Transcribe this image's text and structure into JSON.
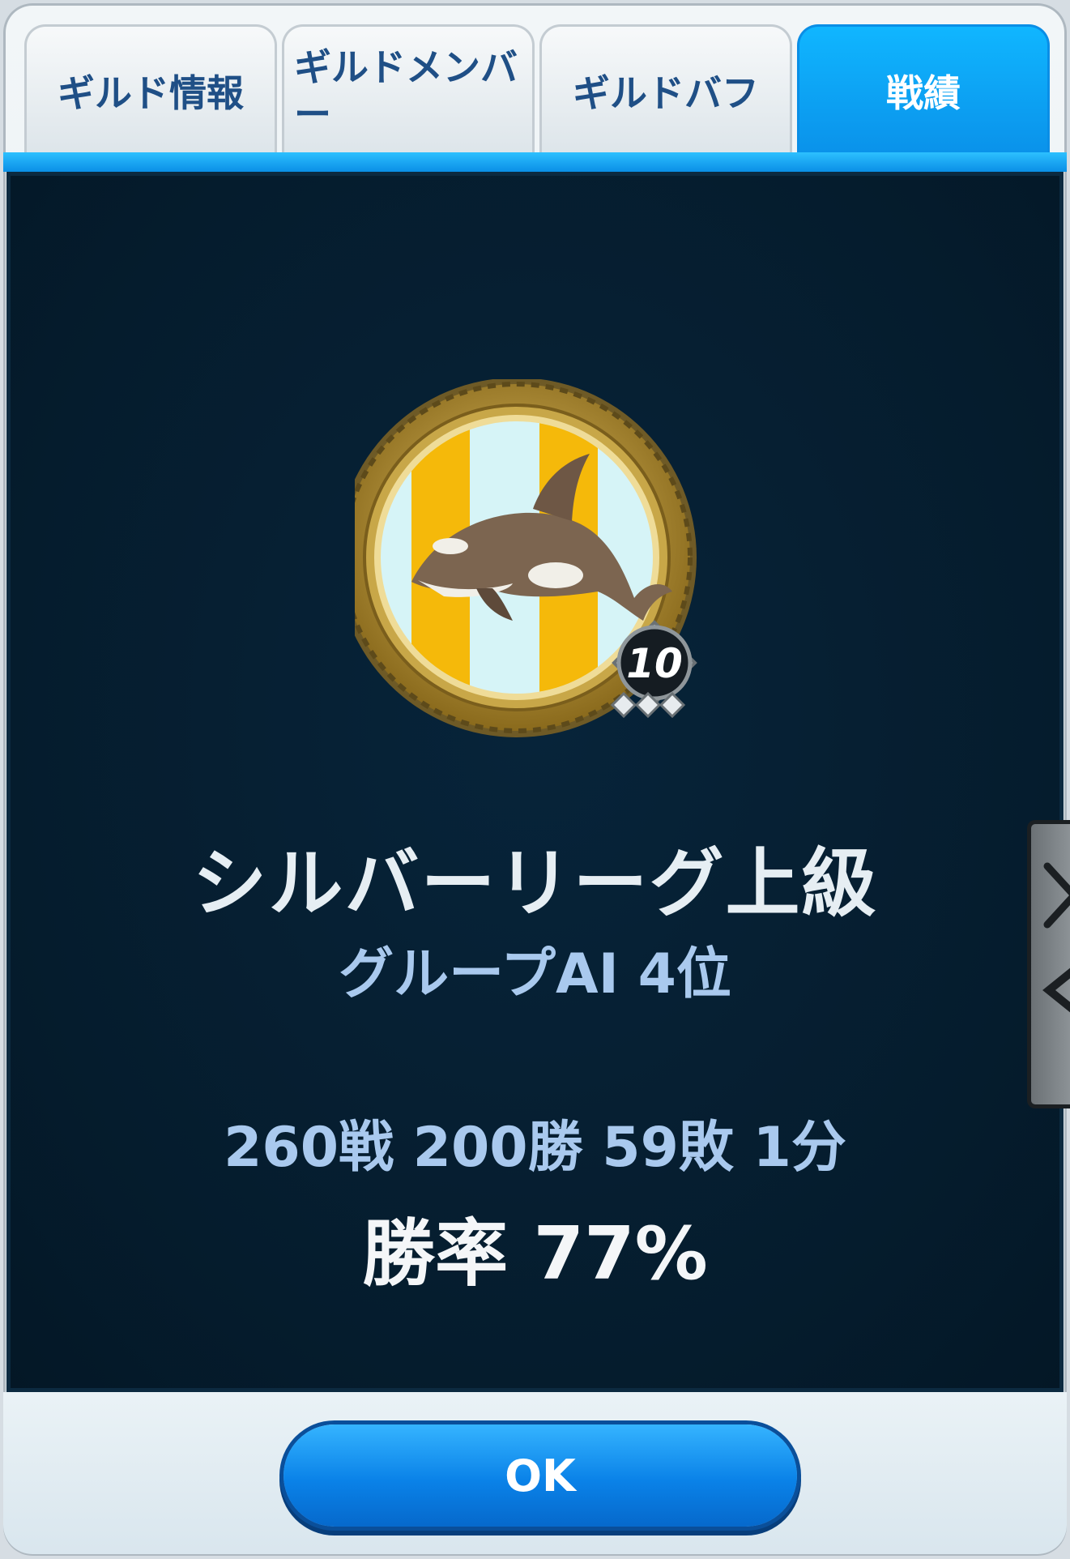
{
  "tabs": [
    {
      "label": "ギルド情報",
      "active": false
    },
    {
      "label": "ギルドメンバー",
      "active": false
    },
    {
      "label": "ギルドバフ",
      "active": false
    },
    {
      "label": "戦績",
      "active": true
    }
  ],
  "emblem": {
    "icon": "orca-medal-icon",
    "badge_number": "10",
    "colors": {
      "stripe_a": "#f5b90a",
      "stripe_b": "#d6f4f7",
      "rim": "#b08a2a"
    }
  },
  "result": {
    "league": "シルバーリーグ上級",
    "group_rank": "グループAI 4位",
    "record": "260戦 200勝 59敗 1分",
    "win_rate": "勝率 77%"
  },
  "buttons": {
    "ok": "OK"
  },
  "side_handle": {
    "icon": "close-arrow-icon"
  }
}
